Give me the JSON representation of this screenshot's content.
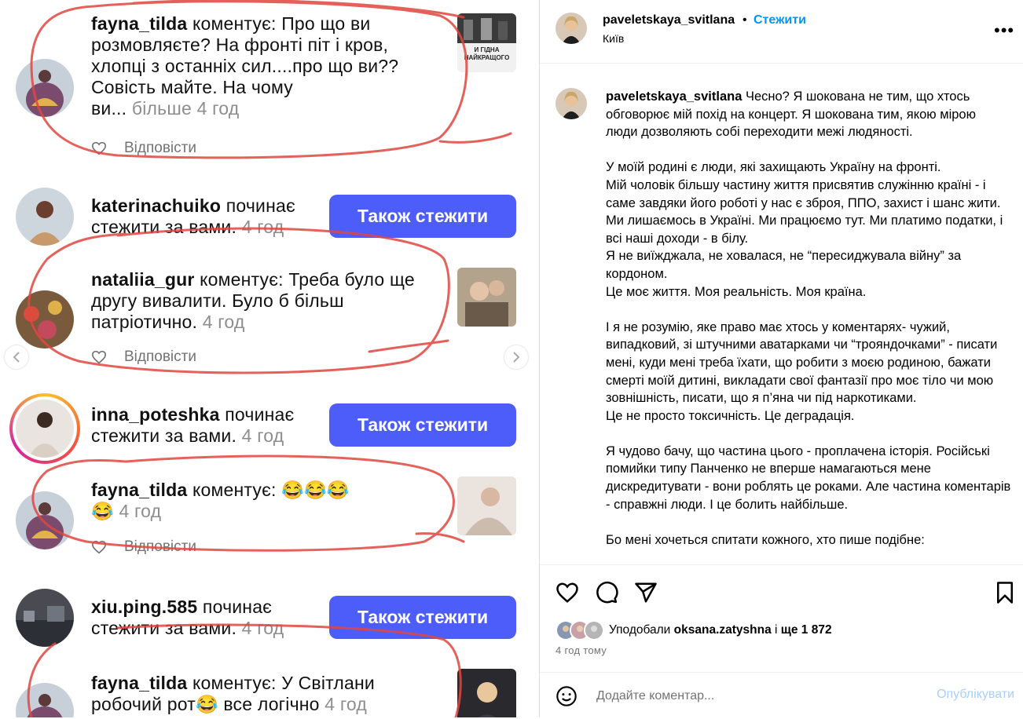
{
  "left_image": {
    "notifications": [
      {
        "type": "comment",
        "username": "fayna_tilda",
        "action": "коментує:",
        "lines": [
          "Про що ви",
          "розмовляєте? На фронті піт і кров,",
          "хлопці з останніх сил....про що ви??",
          "Совість майте. На чому"
        ],
        "tail": "ви...",
        "more": "більше",
        "time": "4 год",
        "reply": "Відповісти",
        "thumb_text": [
          "И ГІДНА",
          "НАЙКРАЩОГО"
        ]
      },
      {
        "type": "follow",
        "username": "katerinachuiko",
        "action": "починає",
        "line2": "стежити за вами.",
        "time": "4 год",
        "button": "Також стежити"
      },
      {
        "type": "comment",
        "username": "nataliia_gur",
        "action": "коментує:",
        "lines": [
          "Треба було ще",
          "другу вивалити. Було б більш",
          "патріотично."
        ],
        "time": "4 год",
        "reply": "Відповісти"
      },
      {
        "type": "follow",
        "username": "inna_poteshka",
        "action": "починає",
        "line2": "стежити за вами.",
        "time": "4 год",
        "button": "Також стежити"
      },
      {
        "type": "comment",
        "username": "fayna_tilda",
        "action": "коментує:",
        "emoji": "😂😂😂",
        "line2_emoji": "😂",
        "time": "4 год",
        "reply": "Відповісти"
      },
      {
        "type": "follow",
        "username": "xiu.ping.585",
        "action": "починає",
        "line2": "стежити за вами.",
        "time": "4 год",
        "button": "Також стежити"
      },
      {
        "type": "comment",
        "username": "fayna_tilda",
        "action": "коментує:",
        "lines": [
          "У Світлани"
        ],
        "line2a": "робочий рот",
        "line2b": "все логічно",
        "emoji": "😂",
        "time": "4 год"
      }
    ]
  },
  "post": {
    "header": {
      "username": "paveletskaya_svitlana",
      "separator": "•",
      "follow": "Стежити",
      "location": "Київ",
      "more": "•••"
    },
    "caption": {
      "username": "paveletskaya_svitlana",
      "paragraphs": [
        [
          "Чесно? Я шокована не тим, що хтось обговорює мій похід на концерт. Я шокована тим, якою мірою люди дозволяють собі переходити межі людяності."
        ],
        [
          "У моїй родині є люди, які захищають Україну на фронті.",
          "Мій чоловік більшу частину життя присвятив служінню країні - і саме завдяки його роботі у нас є зброя, ППО, захист і шанс жити.",
          "Ми лишаємось в Україні. Ми працюємо тут. Ми платимо податки, і всі наші доходи - в білу.",
          "Я не виїжджала, не ховалася, не “пересиджувала війну” за кордоном.",
          "Це моє життя. Моя реальність. Моя країна."
        ],
        [
          "І я не розумію, яке право має хтось у коментарях- чужий, випадковий, зі штучними аватарками чи “трояндочками” - писати мені, куди мені треба їхати, що робити з моєю родиною, бажати смерті моїй дитині, викладати свої фантазії про моє тіло чи мою зовнішність, писати, що я п’яна чи під наркотиками.",
          "Це не просто токсичність. Це деградація."
        ],
        [
          "Я чудово бачу, що частина цього - проплачена історія. Російські помийки типу Панченко не вперше намагаються мене дискредитувати - вони роблять це роками. Але частина коментарів - справжні люди. І це болить найбільше."
        ],
        [
          "Бо мені хочеться спитати кожного, хто пише подібне:"
        ]
      ]
    },
    "actions": {
      "icons": [
        "heart-icon",
        "comment-icon",
        "share-icon",
        "bookmark-icon"
      ]
    },
    "likes": {
      "prefix": "Уподобали",
      "user": "oksana.zatyshna",
      "middle": "і",
      "count": "ще 1 872"
    },
    "time": "4 год тому",
    "comment": {
      "placeholder": "Додайте коментар...",
      "publish": "Опублікувати"
    }
  },
  "colors": {
    "follow_link": "#0095f6",
    "follow_button": "#4d5dfa",
    "scribble": "#e0463f",
    "publish_disabled": "#a9cffa"
  }
}
